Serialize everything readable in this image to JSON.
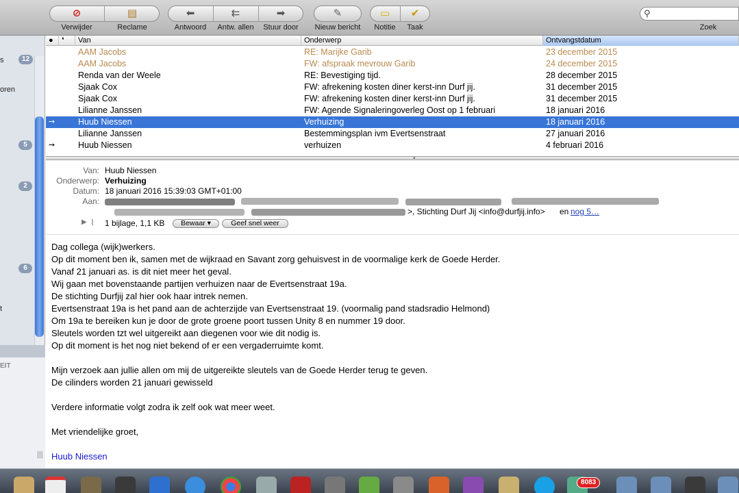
{
  "toolbar": {
    "delete": "Verwijder",
    "junk": "Reclame",
    "reply": "Antwoord",
    "reply_all": "Antw. allen",
    "forward": "Stuur door",
    "new_message": "Nieuw bericht",
    "note": "Notitie",
    "todo": "Taak",
    "search_label": "Zoek",
    "search_placeholder": ""
  },
  "sidebar": {
    "badges": [
      "12",
      "5",
      "2",
      "6"
    ],
    "text_oren": "oren",
    "text_eit": "EIT"
  },
  "list": {
    "columns": {
      "from": "Van",
      "subject": "Onderwerp",
      "date": "Ontvangstdatum"
    },
    "rows": [
      {
        "from": "AAM Jacobs",
        "subject": "RE: Marijke Garib",
        "date": "23 december 2015",
        "flag": ""
      },
      {
        "from": "AAM Jacobs",
        "subject": "FW: afspraak mevrouw Garib",
        "date": "24 december 2015",
        "flag": ""
      },
      {
        "from": "Renda van der Weele",
        "subject": "RE: Bevestiging tijd.",
        "date": "28 december 2015",
        "flag": ""
      },
      {
        "from": "Sjaak Cox",
        "subject": "FW: afrekening kosten diner kerst-inn Durf jij.",
        "date": "31 december 2015",
        "flag": ""
      },
      {
        "from": "Sjaak Cox",
        "subject": "FW: afrekening kosten diner kerst-inn Durf jij.",
        "date": "31 december 2015",
        "flag": ""
      },
      {
        "from": "Lilianne Janssen",
        "subject": "FW: Agende Signaleringoverleg Oost op 1 februari",
        "date": "18 januari 2016",
        "flag": ""
      },
      {
        "from": "Huub Niessen",
        "subject": "Verhuizing",
        "date": "18 januari 2016",
        "flag": "➙"
      },
      {
        "from": "Lilianne Janssen",
        "subject": "Bestemmingsplan ivm Evertsenstraat",
        "date": "27 januari 2016",
        "flag": ""
      },
      {
        "from": "Huub Niessen",
        "subject": "verhuizen",
        "date": "4 februari 2016",
        "flag": "➙"
      }
    ]
  },
  "message": {
    "labels": {
      "from": "Van:",
      "subject": "Onderwerp:",
      "date": "Datum:",
      "to": "Aan:"
    },
    "from": "Huub Niessen",
    "subject": "Verhuizing",
    "date": "18 januari 2016 15:39:03 GMT+01:00",
    "to_tail": ">,  Stichting Durf Jij <info@durfjij.info>",
    "to_en": "en",
    "to_more": "nog 5…",
    "attachment": "1 bijlage, 1,1 KB",
    "save_btn": "Bewaar ▾",
    "quicklook_btn": "Geef snel weer",
    "body": [
      "Dag collega (wijk)werkers.",
      "Op dit moment ben ik, samen met de wijkraad en Savant zorg gehuisvest in de voormalige kerk de Goede Herder.",
      "Vanaf 21 januari as. is dit niet meer het geval.",
      "Wij gaan met bovenstaande partijen verhuizen naar de Evertsenstraat 19a.",
      "De stichting Durfjij zal hier ook haar intrek nemen.",
      "Evertsenstraat 19a is het pand aan de achterzijde van Evertsenstraat 19. (voormalig pand stadsradio Helmond)",
      "Om 19a te bereiken kun je door de grote groene poort tussen Unity 8 en nummer 19 door.",
      "Sleutels worden tzt wel uitgereikt aan diegenen voor wie dit nodig is.",
      "Op dit moment is het nog niet bekend of er een vergaderruimte komt.",
      "",
      "Mijn verzoek aan jullie allen om mij de uitgereikte sleutels van de Goede Herder terug te geven.",
      "De cilinders worden 21 januari gewisseld",
      "",
      "Verdere informatie volgt zodra ik zelf  ook wat meer weet.",
      "",
      "Met vriendelijke groet,",
      "",
      "Huub Niessen"
    ]
  },
  "dock": {
    "badge": "8083"
  },
  "colors": {
    "selection": "#3875d7",
    "read_orange": "#b98a4e",
    "link": "#1f3fae"
  }
}
